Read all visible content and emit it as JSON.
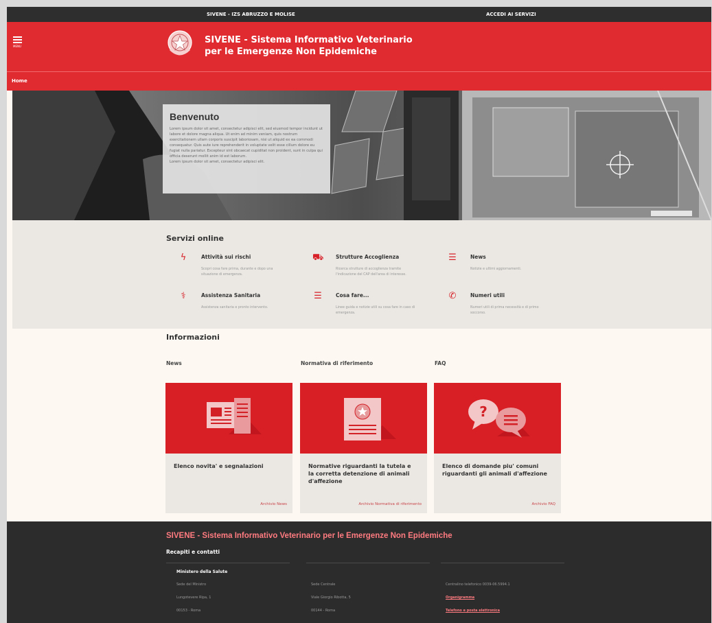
{
  "topbar": {
    "site_label": "SIVENE - IZS ABRUZZO E MOLISE",
    "login_label": "ACCEDI AI SERVIZI"
  },
  "header": {
    "menu_label": "MENU",
    "title_line1": "SIVENE - Sistema Informativo Veterinario",
    "title_line2": "per le Emergenze Non Epidemiche"
  },
  "breadcrumb": {
    "home": "Home"
  },
  "hero": {
    "title": "Benvenuto",
    "text": "Lorem ipsum dolor sit amet, consectetur adipisci elit, sed eiusmod tempor incidunt ut labore et dolore magna aliqua. Ut enim ad minim veniam, quis nostrum exercitationem ullam corporis suscipit laboriosam, nisi ut aliquid ex ea commodi consequatur. Quis aute iure reprehenderit in voluptate velit esse cillum dolore eu fugiat nulla pariatur. Excepteur sint obcaecat cupiditat non proident, sunt in culpa qui officia deserunt mollit anim id est laborum.",
    "text2": "Lorem ipsum dolor sit amet, consectetur adipisci elit."
  },
  "servizi": {
    "title": "Servizi online",
    "items": [
      {
        "icon": "lightning-icon",
        "glyph": "ϟ",
        "title": "Attività sui rischi",
        "desc": "Scopri cosa fare prima, durante e dopo una situazione di emergenza."
      },
      {
        "icon": "bed-icon",
        "glyph": "⛟",
        "title": "Strutture Accoglienza",
        "desc": "Ricerca strutture di accoglienza tramite l'indicazione del CAP dell'area di interesse."
      },
      {
        "icon": "list-icon",
        "glyph": "☰",
        "title": "News",
        "desc": "Notizie e ultimi aggiornamenti."
      },
      {
        "icon": "medical-person-icon",
        "glyph": "⚕",
        "title": "Assistenza Sanitaria",
        "desc": "Assistenza sanitaria e pronto intervento."
      },
      {
        "icon": "list-icon",
        "glyph": "☰",
        "title": "Cosa fare...",
        "desc": "Linee guida e notizie utili su cosa fare in caso di emergenza."
      },
      {
        "icon": "phone-icon",
        "glyph": "✆",
        "title": "Numeri utili",
        "desc": "Numeri utili di prima necessità e di primo soccorso."
      }
    ]
  },
  "informazioni": {
    "title": "Informazioni",
    "columns": [
      {
        "label": "News",
        "card_title": "Elenco novita' e segnalazioni",
        "link": "Archivio News"
      },
      {
        "label": "Normativa di riferimento",
        "card_title": "Normative riguardanti la tutela e la corretta detenzione di animali d'affezione",
        "link": "Archivio Normativa di riferimento"
      },
      {
        "label": "FAQ",
        "card_title": "Elenco di domande piu' comuni riguardanti gli animali d'affezione",
        "link": "Archivio FAQ"
      }
    ]
  },
  "footer": {
    "title": "SIVENE - Sistema Informativo Veterinario per le Emergenze Non Epidemiche",
    "contacts_title": "Recapiti e contatti",
    "col1": [
      "Ministero della Salute",
      "Sede del Ministro",
      "Lungotevere Ripa, 1",
      "00153 - Roma"
    ],
    "col2": [
      "Sede Centrale",
      "Viale Giorgio Ribotta, 5",
      "00144 - Roma"
    ],
    "col3": [
      "Centralino telefonico 0039-06.5994.1",
      "Organigramma",
      "Telefono e posta elettronica"
    ]
  },
  "colors": {
    "brand_red": "#e02b31",
    "dark": "#2c2c2c",
    "link_red": "#ff7b80"
  }
}
